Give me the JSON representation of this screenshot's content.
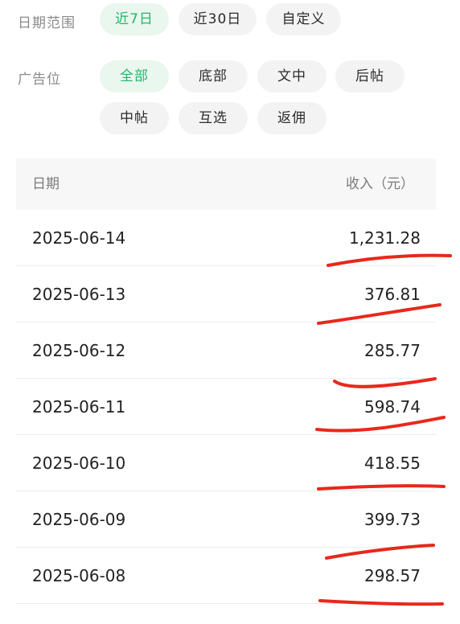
{
  "filters": {
    "date_range": {
      "label": "日期范围",
      "options": [
        "近7日",
        "近30日",
        "自定义"
      ],
      "selected": "近7日"
    },
    "ad_position": {
      "label": "广告位",
      "options": [
        "全部",
        "底部",
        "文中",
        "后帖",
        "中帖",
        "互选",
        "返佣"
      ],
      "selected": "全部"
    }
  },
  "table": {
    "header_date": "日期",
    "header_income": "收入（元）",
    "rows": [
      {
        "date": "2025-06-14",
        "income": "1,231.28"
      },
      {
        "date": "2025-06-13",
        "income": "376.81"
      },
      {
        "date": "2025-06-12",
        "income": "285.77"
      },
      {
        "date": "2025-06-11",
        "income": "598.74"
      },
      {
        "date": "2025-06-10",
        "income": "418.55"
      },
      {
        "date": "2025-06-09",
        "income": "399.73"
      },
      {
        "date": "2025-06-08",
        "income": "298.57"
      }
    ]
  },
  "colors": {
    "accent": "#27b36a",
    "accent_bg": "#e9f7ef",
    "chip_bg": "#f3f3f3",
    "annotation": "#e8281c"
  }
}
